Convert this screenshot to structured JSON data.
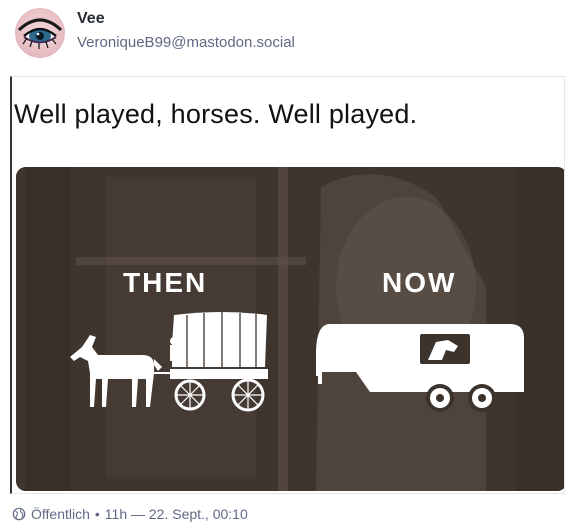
{
  "post": {
    "display_name": "Vee",
    "acct": "VeroniqueB99@mastodon.social",
    "caption": "Well played, horses. Well played.",
    "meme_then": "THEN",
    "meme_now": "NOW",
    "visibility": "Öffentlich",
    "separator": "•",
    "timestamp": "11h — 22. Sept., 00:10"
  },
  "icons": {
    "visibility": "globe-icon"
  },
  "colors": {
    "meta_text": "#606984",
    "name_text": "#282c37",
    "meme_bg": "#3d332d"
  }
}
